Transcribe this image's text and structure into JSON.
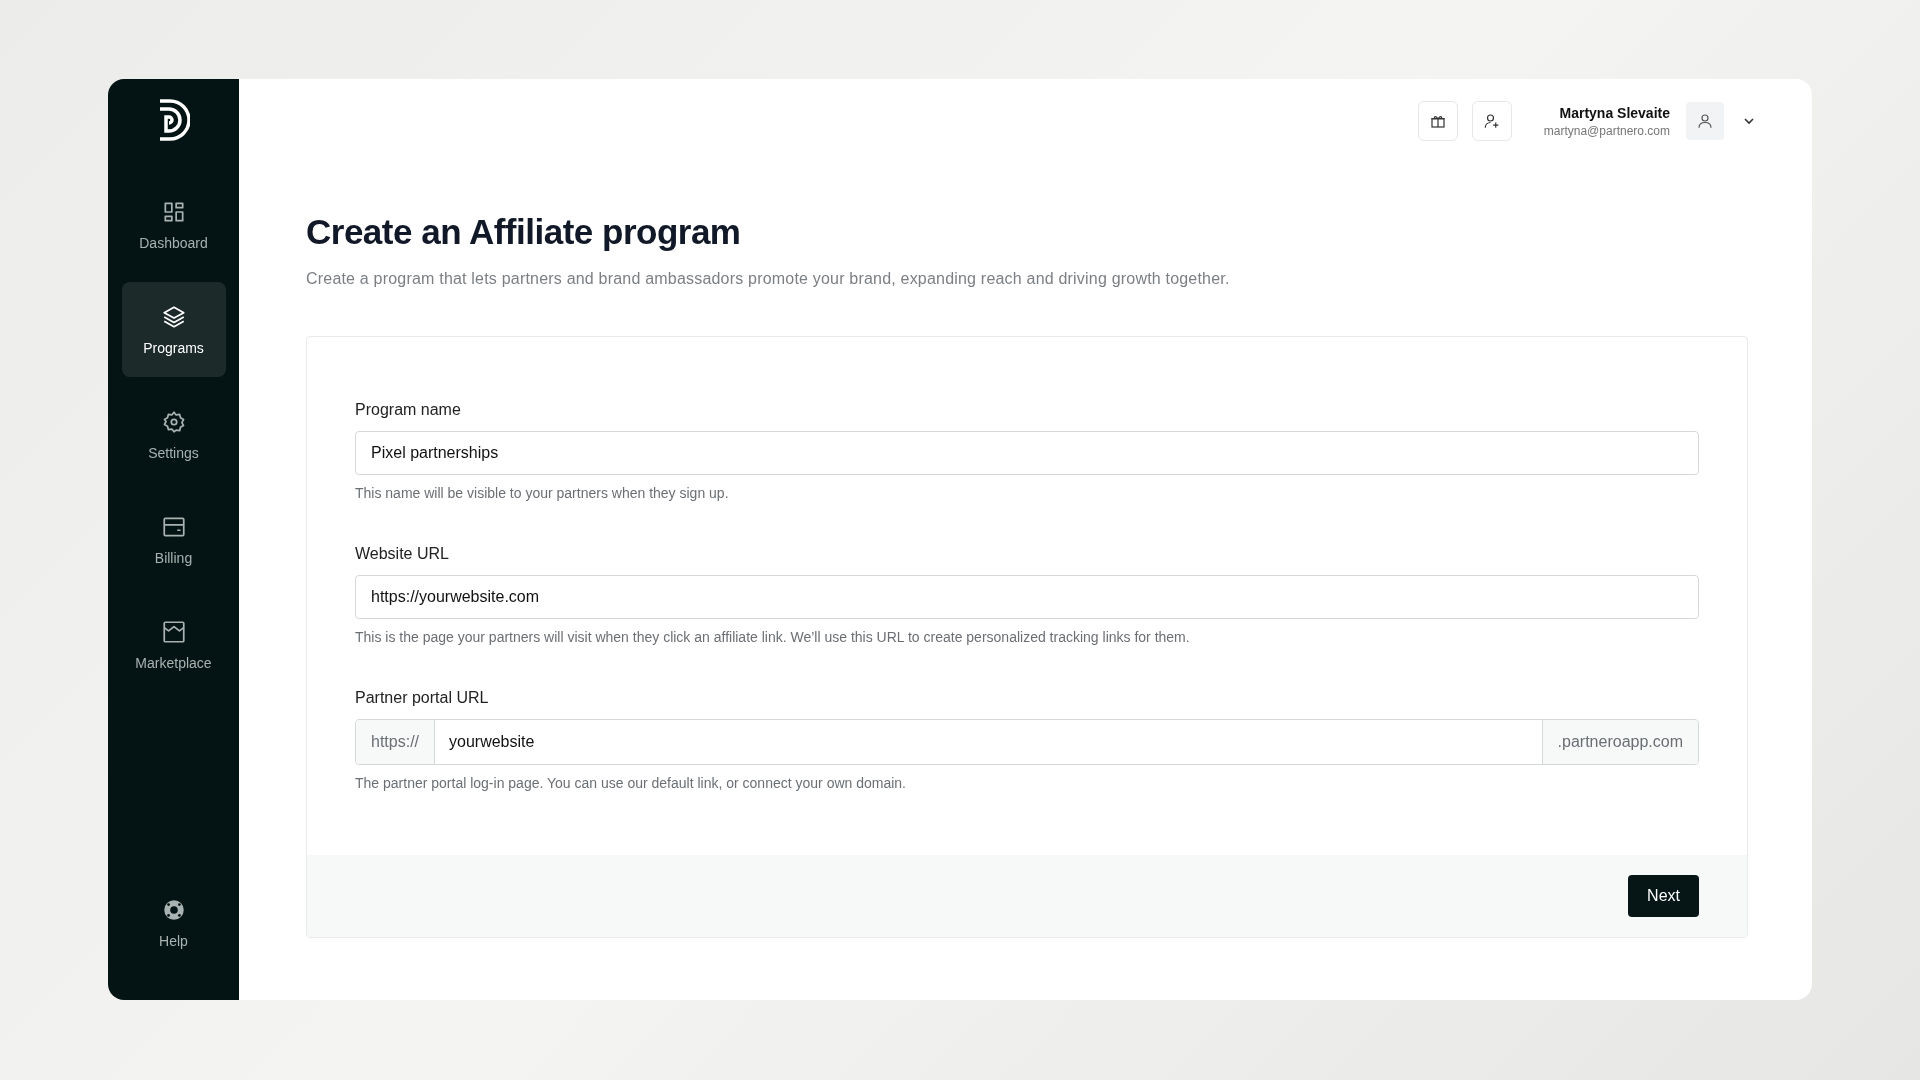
{
  "sidebar": {
    "items": [
      {
        "label": "Dashboard",
        "selected": false
      },
      {
        "label": "Programs",
        "selected": true
      },
      {
        "label": "Settings",
        "selected": false
      },
      {
        "label": "Billing",
        "selected": false
      },
      {
        "label": "Marketplace",
        "selected": false
      }
    ],
    "help": {
      "label": "Help"
    }
  },
  "header": {
    "user": {
      "name": "Martyna Slevaite",
      "email": "martyna@partnero.com"
    }
  },
  "page": {
    "title": "Create an Affiliate program",
    "subtitle": "Create a program that lets partners and brand ambassadors promote your brand, expanding reach and driving growth together."
  },
  "form": {
    "fields": [
      {
        "kind": "text",
        "label": "Program name",
        "value": "Pixel partnerships",
        "hint": "This name will be visible to your partners when they sign up."
      },
      {
        "kind": "text",
        "label": "Website URL",
        "value": "https://yourwebsite.com",
        "hint": "This is the page your partners will visit when they click an affiliate link. We’ll use this URL to create personalized tracking links for them."
      },
      {
        "kind": "affixed",
        "label": "Partner portal URL",
        "prefix": "https://",
        "value": "yourwebsite",
        "suffix": ".partneroapp.com",
        "hint": "The partner portal log-in page. You can use our default link, or connect your own domain."
      }
    ],
    "submit": "Next"
  }
}
